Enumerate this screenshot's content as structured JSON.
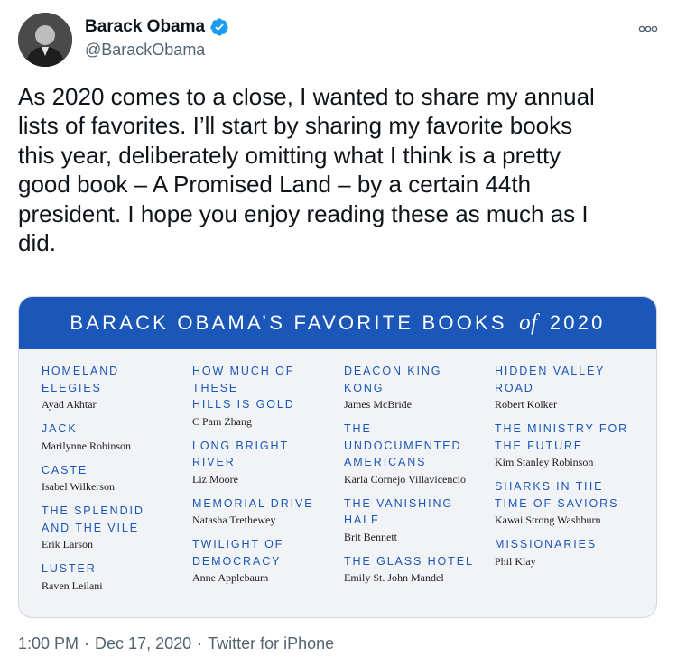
{
  "tweet": {
    "author": {
      "display_name": "Barack Obama",
      "handle": "@BarackObama"
    },
    "text": "As 2020 comes to a close, I wanted to share my annual\nlists of favorites. I’ll start by sharing my favorite books\nthis year, deliberately omitting what I think is a pretty\ngood book – A Promised Land – by a certain 44th\npresident. I hope you enjoy reading these as much as I\ndid.",
    "time": "1:00 PM",
    "separator": "·",
    "date": "Dec 17, 2020",
    "source": "Twitter for iPhone"
  },
  "card": {
    "banner_pre": "BARACK OBAMA’S FAVORITE BOOKS",
    "banner_of": "of",
    "banner_year": "2020",
    "columns": [
      [
        {
          "title": "HOMELAND ELEGIES",
          "author": "Ayad Akhtar"
        },
        {
          "title": "JACK",
          "author": "Marilynne Robinson"
        },
        {
          "title": "CASTE",
          "author": "Isabel Wilkerson"
        },
        {
          "title": "THE SPLENDID AND THE VILE",
          "author": "Erik Larson"
        },
        {
          "title": "LUSTER",
          "author": "Raven Leilani"
        }
      ],
      [
        {
          "title": "HOW MUCH OF THESE HILLS IS GOLD",
          "author": "C Pam Zhang"
        },
        {
          "title": "LONG BRIGHT RIVER",
          "author": "Liz Moore"
        },
        {
          "title": "MEMORIAL DRIVE",
          "author": "Natasha Trethewey"
        },
        {
          "title": "TWILIGHT OF DEMOCRACY",
          "author": "Anne Applebaum"
        }
      ],
      [
        {
          "title": "DEACON KING KONG",
          "author": "James McBride"
        },
        {
          "title": "THE UNDOCUMENTED AMERICANS",
          "author": "Karla Cornejo Villavicencio"
        },
        {
          "title": "THE VANISHING HALF",
          "author": "Brit Bennett"
        },
        {
          "title": "THE GLASS HOTEL",
          "author": "Emily St. John Mandel"
        }
      ],
      [
        {
          "title": "HIDDEN VALLEY ROAD",
          "author": "Robert Kolker"
        },
        {
          "title": "THE MINISTRY FOR THE FUTURE",
          "author": "Kim Stanley Robinson"
        },
        {
          "title": "SHARKS IN THE TIME OF SAVIORS",
          "author": "Kawai Strong Washburn"
        },
        {
          "title": "MISSIONARIES",
          "author": "Phil Klay"
        }
      ]
    ]
  },
  "icons": {
    "verified": "verified-badge-icon",
    "more": "more-options-icon"
  },
  "colors": {
    "banner": "#1a57b8",
    "title_blue": "#1a57b8",
    "card_bg": "#f2f3f6",
    "meta_gray": "#536471",
    "verified": "#1d9bf0"
  }
}
